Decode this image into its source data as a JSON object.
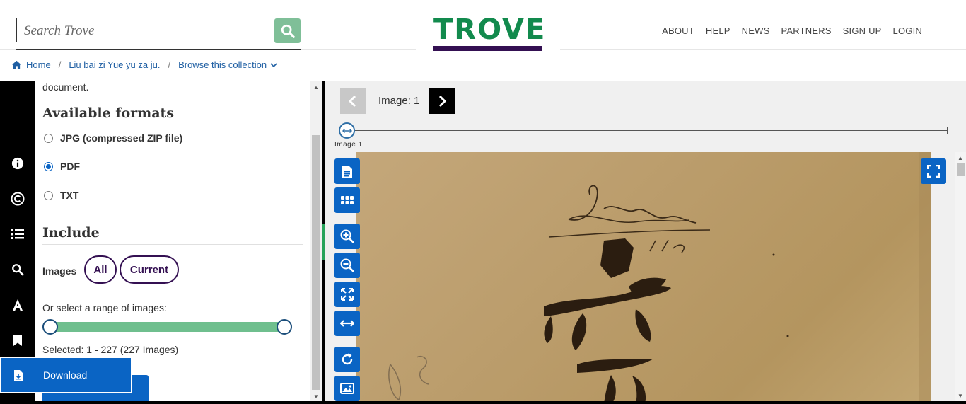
{
  "header": {
    "search": {
      "placeholder": "Search Trove"
    },
    "logo_text": "TROVE",
    "nav": [
      "ABOUT",
      "HELP",
      "NEWS",
      "PARTNERS",
      "SIGN UP",
      "LOGIN"
    ]
  },
  "breadcrumb": {
    "home": "Home",
    "item": "Liu bai zi Yue yu za ju.",
    "browse": "Browse this collection"
  },
  "sidebar": {
    "download_label": "Download"
  },
  "panel": {
    "doc_text": "document.",
    "formats_heading": "Available formats",
    "formats": [
      {
        "label": "JPG (compressed ZIP file)",
        "checked": false
      },
      {
        "label": "PDF",
        "checked": true
      },
      {
        "label": "TXT",
        "checked": false
      }
    ],
    "include_heading": "Include",
    "images_label": "Images",
    "all_label": "All",
    "current_label": "Current",
    "range_label": "Or select a range of images:",
    "range": {
      "min": 1,
      "max": 227
    },
    "selected_text": "Selected: 1 - 227 (227 Images)"
  },
  "viewer": {
    "image_counter": "Image: 1",
    "slider_label": "Image  1"
  },
  "colors": {
    "brand_green": "#128a4d",
    "brand_purple": "#341052",
    "accent_blue": "#0a64c4",
    "range_green": "#6fbf8e"
  }
}
